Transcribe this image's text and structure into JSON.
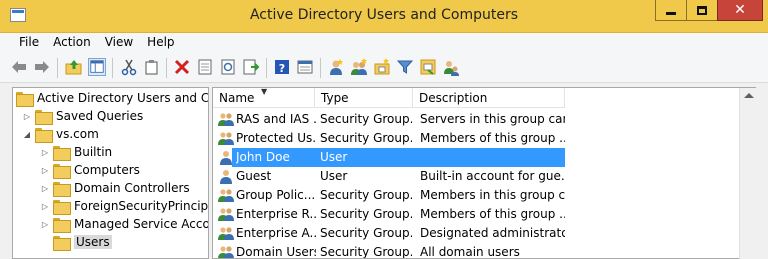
{
  "window": {
    "title": "Active Directory Users and Computers"
  },
  "menu": [
    "File",
    "Action",
    "View",
    "Help"
  ],
  "toolbar": {
    "icons": [
      "back-icon",
      "forward-icon",
      "up-folder-icon",
      "console-tree-icon",
      "cut-icon",
      "copy-icon",
      "delete-icon",
      "properties-icon",
      "refresh-icon",
      "export-list-icon",
      "help-icon",
      "details-icon",
      "new-user-icon",
      "new-group-icon",
      "new-ou-icon",
      "filter-icon",
      "add-to-group-icon",
      "delegate-icon"
    ]
  },
  "tree": {
    "root": "Active Directory Users and Com",
    "saved_queries": "Saved Queries",
    "domain": "vs.com",
    "children": [
      "Builtin",
      "Computers",
      "Domain Controllers",
      "ForeignSecurityPrincipal:",
      "Managed Service Accour",
      "Users"
    ]
  },
  "list": {
    "columns": {
      "name": "Name",
      "type": "Type",
      "description": "Description"
    },
    "rows": [
      {
        "name": "RAS and IAS ...",
        "type": "Security Group...",
        "description": "Servers in this group can...",
        "icon": "group-icon"
      },
      {
        "name": "Protected Us...",
        "type": "Security Group...",
        "description": "Members of this group ...",
        "icon": "group-icon"
      },
      {
        "name": "John Doe",
        "type": "User",
        "description": "",
        "icon": "user-icon",
        "selected": true
      },
      {
        "name": "Guest",
        "type": "User",
        "description": "Built-in account for gue...",
        "icon": "user-icon"
      },
      {
        "name": "Group Polic...",
        "type": "Security Group...",
        "description": "Members in this group c...",
        "icon": "group-icon"
      },
      {
        "name": "Enterprise R...",
        "type": "Security Group...",
        "description": "Members of this group ...",
        "icon": "group-icon"
      },
      {
        "name": "Enterprise A...",
        "type": "Security Group...",
        "description": "Designated administrato...",
        "icon": "group-icon"
      },
      {
        "name": "Domain Users",
        "type": "Security Group...",
        "description": "All domain users",
        "icon": "group-icon"
      }
    ]
  }
}
